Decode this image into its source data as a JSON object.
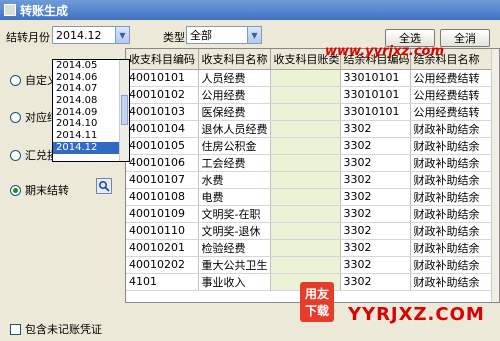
{
  "window": {
    "title": "转账生成"
  },
  "filters": {
    "month_label": "结转月份",
    "month_value": "2014.12",
    "type_label": "类型",
    "type_value": "全部",
    "select_all": "全选",
    "deselect_all": "全消"
  },
  "month_options": [
    "2014.05",
    "2014.06",
    "2014.07",
    "2014.08",
    "2014.09",
    "2014.10",
    "2014.11",
    "2014.12"
  ],
  "options": [
    {
      "label": "自定义转账",
      "selected": false
    },
    {
      "label": "对应结转",
      "selected": false
    },
    {
      "label": "汇兑损益结转",
      "selected": false
    },
    {
      "label": "期末结转",
      "selected": true
    }
  ],
  "include_unposted": "包含未记账凭证",
  "grid": {
    "columns": [
      "收支科目编码",
      "收支科目名称",
      "收支科目账类",
      "结余科目编码",
      "结余科目名称"
    ],
    "rows": [
      [
        "40010101",
        "人员经费",
        "",
        "33010101",
        "公用经费结转"
      ],
      [
        "40010102",
        "公用经费",
        "",
        "33010101",
        "公用经费结转"
      ],
      [
        "40010103",
        "医保经费",
        "",
        "33010101",
        "公用经费结转"
      ],
      [
        "40010104",
        "退休人员经费",
        "",
        "3302",
        "财政补助结余"
      ],
      [
        "40010105",
        "住房公积金",
        "",
        "3302",
        "财政补助结余"
      ],
      [
        "40010106",
        "工会经费",
        "",
        "3302",
        "财政补助结余"
      ],
      [
        "40010107",
        "水费",
        "",
        "3302",
        "财政补助结余"
      ],
      [
        "40010108",
        "电费",
        "",
        "3302",
        "财政补助结余"
      ],
      [
        "40010109",
        "文明奖-在职",
        "",
        "3302",
        "财政补助结余"
      ],
      [
        "40010110",
        "文明奖-退休",
        "",
        "3302",
        "财政补助结余"
      ],
      [
        "40010201",
        "检验经费",
        "",
        "3302",
        "财政补助结余"
      ],
      [
        "40010202",
        "重大公共卫生",
        "",
        "3302",
        "财政补助结余"
      ],
      [
        "4101",
        "事业收入",
        "",
        "3302",
        "财政补助结余"
      ]
    ]
  },
  "watermark": {
    "site": "www.yyrjxz.com",
    "badge_top": "用友",
    "badge_bottom": "下载",
    "brand": "YYRJXZ.COM"
  }
}
